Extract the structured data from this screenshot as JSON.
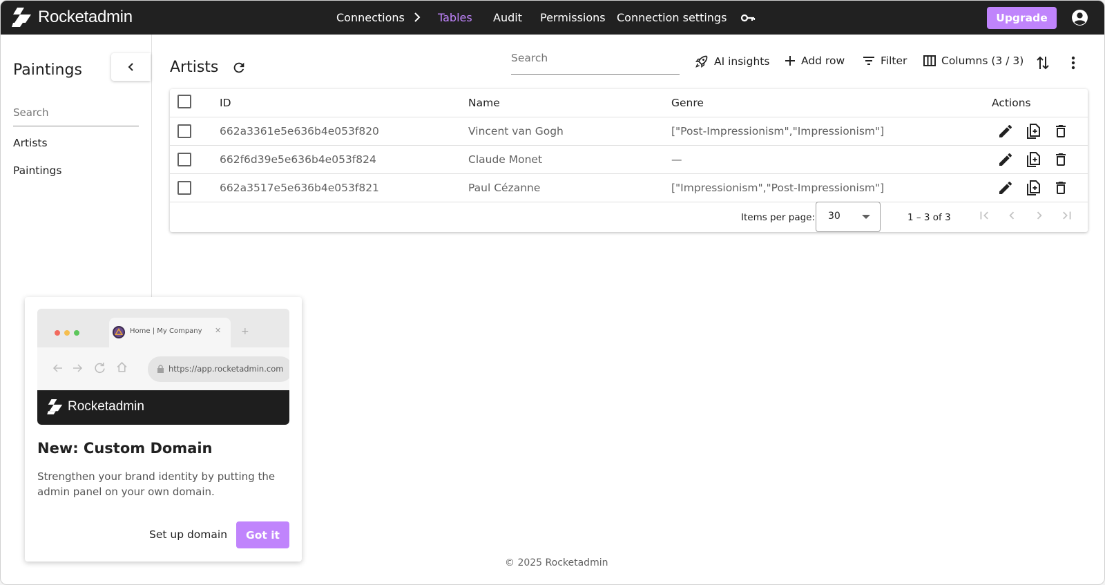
{
  "header": {
    "brand": "Rocketadmin",
    "nav": {
      "connections": "Connections",
      "tables": "Tables",
      "audit": "Audit",
      "permissions": "Permissions",
      "connection_settings": "Connection settings"
    },
    "upgrade": "Upgrade",
    "icons": [
      "rocketadmin-logo-icon",
      "chevron-right-icon",
      "key-icon",
      "account-circle-icon"
    ]
  },
  "colors": {
    "topbar": "#212121",
    "accent": "#c084fc",
    "text": "#212121",
    "muted": "#616161"
  },
  "sidebar": {
    "title": "Paintings",
    "search_placeholder": "Search",
    "items": [
      {
        "label": "Artists"
      },
      {
        "label": "Paintings"
      }
    ]
  },
  "main": {
    "title": "Artists",
    "search_placeholder": "Search",
    "toolbar": {
      "ai_insights": "AI insights",
      "add_row": "Add row",
      "filter": "Filter",
      "columns": "Columns (3 / 3)"
    },
    "table": {
      "headers": {
        "id": "ID",
        "name": "Name",
        "genre": "Genre",
        "actions": "Actions"
      },
      "rows": [
        {
          "id": "662a3361e5e636b4e053f820",
          "name": "Vincent van Gogh",
          "genre": "[\"Post-Impressionism\",\"Impressionism\"]"
        },
        {
          "id": "662f6d39e5e636b4e053f824",
          "name": "Claude Monet",
          "genre": "—"
        },
        {
          "id": "662a3517e5e636b4e053f821",
          "name": "Paul Cézanne",
          "genre": "[\"Impressionism\",\"Post-Impressionism\"]"
        }
      ]
    },
    "pagination": {
      "items_per_page_label": "Items per page:",
      "items_per_page": "30",
      "range": "1 – 3 of 3"
    }
  },
  "promo": {
    "browser_tab": "Home | My Company",
    "browser_url": "https://app.rocketadmin.com",
    "brand": "Rocketadmin",
    "title": "New: Custom Domain",
    "text": "Strengthen your brand identity by putting the admin panel on your own domain.",
    "setup": "Set up domain",
    "got_it": "Got it"
  },
  "footer": "© 2025 Rocketadmin"
}
